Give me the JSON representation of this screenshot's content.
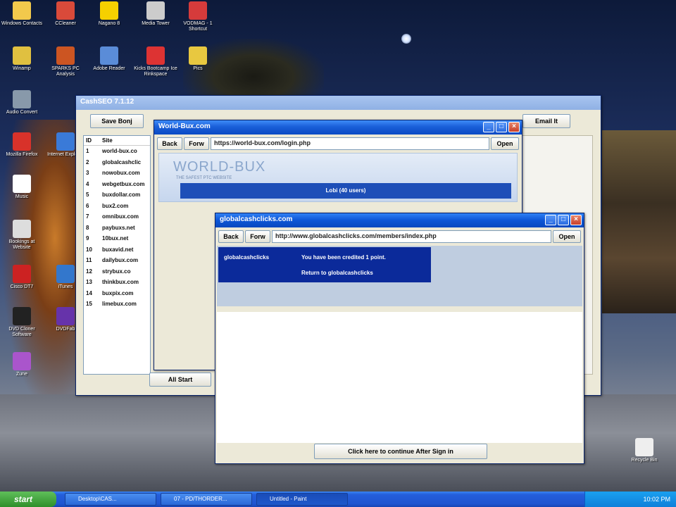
{
  "desktop": {
    "icons": [
      {
        "label": "Windows Contacts",
        "color": "#f2c94c"
      },
      {
        "label": "CCleaner",
        "color": "#d94a3a"
      },
      {
        "label": "Nagano 8",
        "color": "#f5d000"
      },
      {
        "label": "Media Tower",
        "color": "#cccccc"
      },
      {
        "label": "VODMAG - 1 Shortcut",
        "color": "#d63b3b"
      },
      {
        "label": "Winamp",
        "color": "#e0c040"
      },
      {
        "label": "SPARKS PC Analysis",
        "color": "#cc5522"
      },
      {
        "label": "Adobe Reader",
        "color": "#5a8cd8"
      },
      {
        "label": "Kicks Bootcamp Ice Rinkspace",
        "color": "#dd3333"
      },
      {
        "label": "Pics",
        "color": "#e8c840"
      },
      {
        "label": "Audio Convert",
        "color": "#8899aa"
      },
      {
        "label": "Mozilla Firefox",
        "color": "#d8322a"
      },
      {
        "label": "Internet Explorer",
        "color": "#3a7ad8"
      },
      {
        "label": "Music",
        "color": "#ffffff"
      },
      {
        "label": "Bookings at Website",
        "color": "#dddddd"
      },
      {
        "label": "Cisco DT7",
        "color": "#cc2222"
      },
      {
        "label": "iTunes",
        "color": "#3377cc"
      },
      {
        "label": "DVD Cloner Software",
        "color": "#222222"
      },
      {
        "label": "DVDFab",
        "color": "#6633aa"
      },
      {
        "label": "Zune",
        "color": "#aa55cc"
      },
      {
        "label": "Recycle Bin",
        "color": "#eeeeee"
      }
    ]
  },
  "main_window": {
    "title": "CashSEO 7.1.12",
    "save_button": "Save Bonj",
    "email_button": "Email It",
    "all_start_button": "All Start",
    "list_header": {
      "col1": "ID",
      "col2": "Site"
    },
    "rows": [
      {
        "id": "1",
        "site": "world-bux.co"
      },
      {
        "id": "2",
        "site": "globalcashclic"
      },
      {
        "id": "3",
        "site": "nowobux.com"
      },
      {
        "id": "4",
        "site": "webgetbux.com"
      },
      {
        "id": "5",
        "site": "buxdollar.com"
      },
      {
        "id": "6",
        "site": "bux2.com"
      },
      {
        "id": "7",
        "site": "omnibux.com"
      },
      {
        "id": "8",
        "site": "paybuxs.net"
      },
      {
        "id": "9",
        "site": "10bux.net"
      },
      {
        "id": "10",
        "site": "buxavid.net"
      },
      {
        "id": "11",
        "site": "dailybux.com"
      },
      {
        "id": "12",
        "site": "strybux.co"
      },
      {
        "id": "13",
        "site": "thinkbux.com"
      },
      {
        "id": "14",
        "site": "buxpix.com"
      },
      {
        "id": "15",
        "site": "limebux.com"
      }
    ]
  },
  "browser1": {
    "title": "World-Bux.com",
    "back_label": "Back",
    "forward_label": "Forw",
    "url": "https://world-bux.com/login.php",
    "open_button": "Open",
    "logo": "WORLD-BUX",
    "logo_sub": "THE SAFEST PTC WEBSITE",
    "banner_text": "Lobi (40 users)"
  },
  "browser2": {
    "title": "globalcashclicks.com",
    "back_label": "Back",
    "forward_label": "Forw",
    "url": "http://www.globalcashclicks.com/members/index.php",
    "open_button": "Open",
    "notice_site": "globalcashclicks",
    "notice_msg": "You have been credited 1 point.",
    "notice_return": "Return to globalcashclicks",
    "continue_button": "Click here to continue After Sign in"
  },
  "taskbar": {
    "start_label": "start",
    "tasks": [
      "Desktop\\CAS...",
      "07 - PD/THORDER...",
      "Untitled - Paint"
    ],
    "clock": "10:02 PM"
  }
}
